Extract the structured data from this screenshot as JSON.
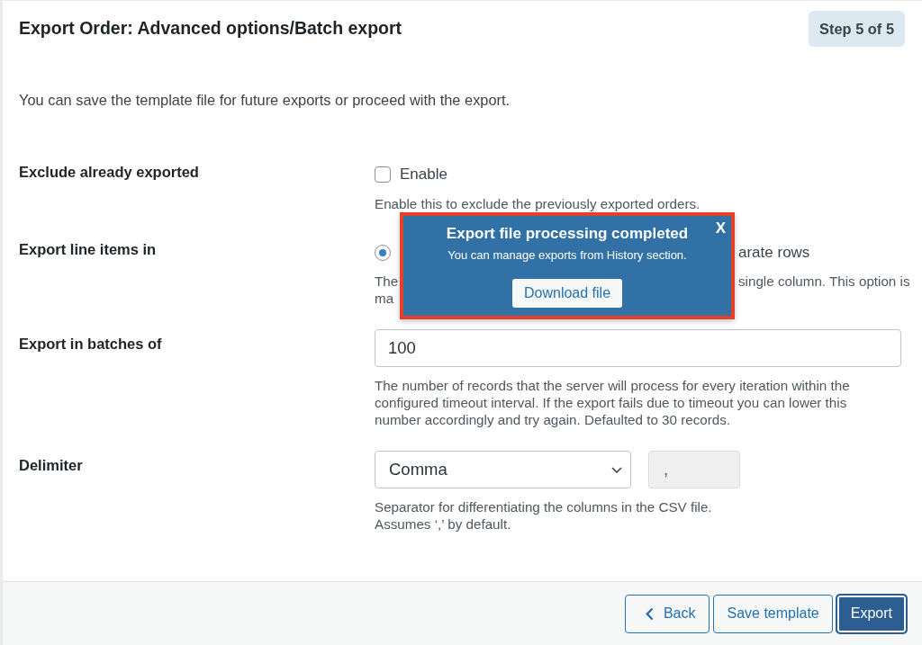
{
  "header": {
    "title": "Export Order: Advanced options/Batch export",
    "step_badge": "Step 5 of 5"
  },
  "description": "You can save the template file for future exports or proceed with the export.",
  "fields": [
    {
      "kind": "checkbox",
      "label": "Exclude already exported",
      "option": "Enable",
      "checked": false,
      "help_lines": [
        "Enable this to exclude the previously exported orders."
      ]
    },
    {
      "kind": "radio",
      "label": "Export line items in",
      "radio_selected": true,
      "option_fragment": "arate rows",
      "help_fragments": [
        {
          "left": "The",
          "right": "single column. This option is"
        },
        {
          "left": "ma"
        }
      ]
    },
    {
      "kind": "text",
      "label": "Export in batches of",
      "value": "100",
      "help_lines": [
        "The number of records that the server will process for every iteration within the",
        "configured timeout interval. If the export fails due to timeout you can lower this",
        "number accordingly and try again. Defaulted to 30 records."
      ]
    },
    {
      "kind": "select",
      "label": "Delimiter",
      "value": "Comma",
      "extra_field": {
        "value": ",",
        "disabled": true
      },
      "help_lines": [
        "Separator for differentiating the columns in the CSV file.",
        "Assumes ‘,’ by default."
      ]
    }
  ],
  "popup": {
    "title": "Export file processing completed",
    "message": "You can manage exports from History section.",
    "button": "Download file",
    "close": "X"
  },
  "footer_buttons": [
    {
      "kind": "back",
      "label": "Back",
      "focused": false
    },
    {
      "kind": "secondary",
      "label": "Save template",
      "focused": false
    },
    {
      "kind": "primary",
      "label": "Export",
      "focused": true
    }
  ]
}
